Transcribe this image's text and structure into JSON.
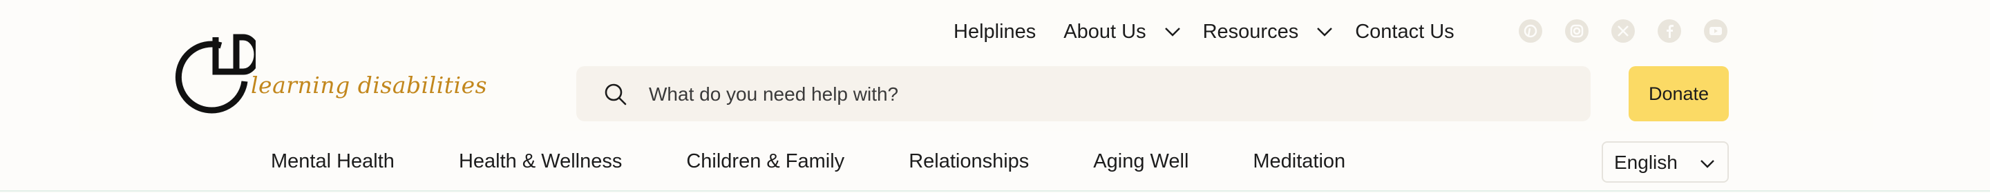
{
  "brand": {
    "logo_letters": "LD",
    "logo_tagline": "learning disabilities",
    "tagline_color": "#c2871d"
  },
  "top_nav": {
    "items": [
      {
        "label": "Helplines",
        "has_dropdown": false
      },
      {
        "label": "About Us",
        "has_dropdown": true
      },
      {
        "label": "Resources",
        "has_dropdown": true
      },
      {
        "label": "Contact Us",
        "has_dropdown": false
      }
    ]
  },
  "social": [
    "pinterest-icon",
    "instagram-icon",
    "x-icon",
    "facebook-icon",
    "youtube-icon"
  ],
  "search": {
    "placeholder": "What do you need help with?",
    "value": ""
  },
  "donate": {
    "label": "Donate",
    "color": "#fbda65"
  },
  "categories": [
    "Mental Health",
    "Health & Wellness",
    "Children & Family",
    "Relationships",
    "Aging Well",
    "Meditation"
  ],
  "language": {
    "selected": "English"
  }
}
